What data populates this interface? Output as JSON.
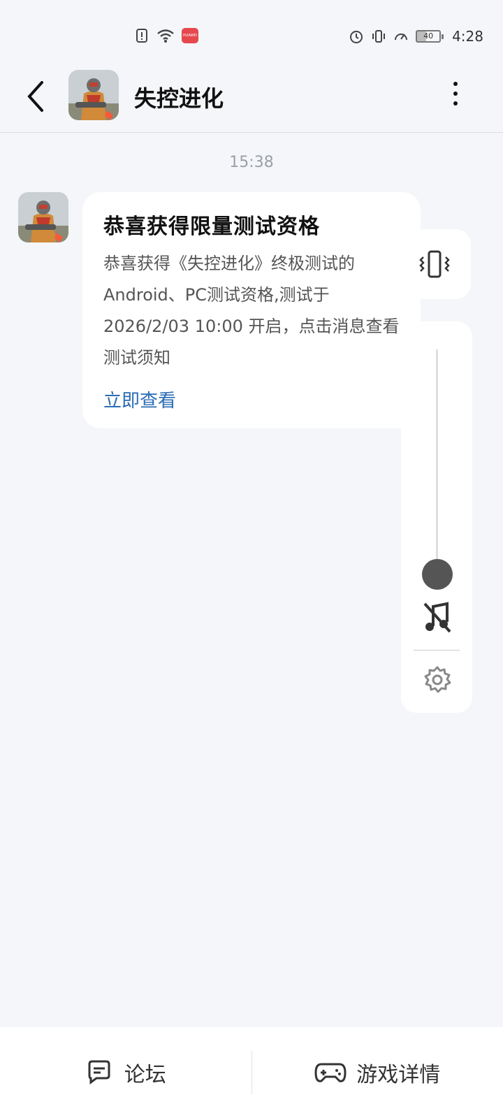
{
  "status_bar": {
    "time": "4:28",
    "battery": "40",
    "brand_badge": "HUAWEI",
    "icons": [
      "alert-icon",
      "wifi-icon",
      "huawei-store-icon",
      "alarm-icon",
      "vibrate-icon",
      "speed-icon",
      "battery-icon"
    ]
  },
  "header": {
    "title": "失控进化",
    "back_icon": "chevron-left-icon",
    "more_icon": "more-vertical-icon"
  },
  "chat": {
    "timestamp": "15:38",
    "message": {
      "title": "恭喜获得限量测试资格",
      "body": "恭喜获得《失控进化》终极测试的Android、PC测试资格,测试于 2026/2/03 10:00 开启，点击消息查看测试须知",
      "link": "立即查看"
    }
  },
  "volume_panel": {
    "level": 0.0,
    "icons": [
      "vibrate-icon",
      "music-off-icon",
      "settings-gear-icon"
    ]
  },
  "bottom_bar": {
    "forum_label": "论坛",
    "game_details_label": "游戏详情"
  },
  "colors": {
    "background": "#f5f6f9",
    "link": "#2a6cb5",
    "card": "#ffffff"
  }
}
